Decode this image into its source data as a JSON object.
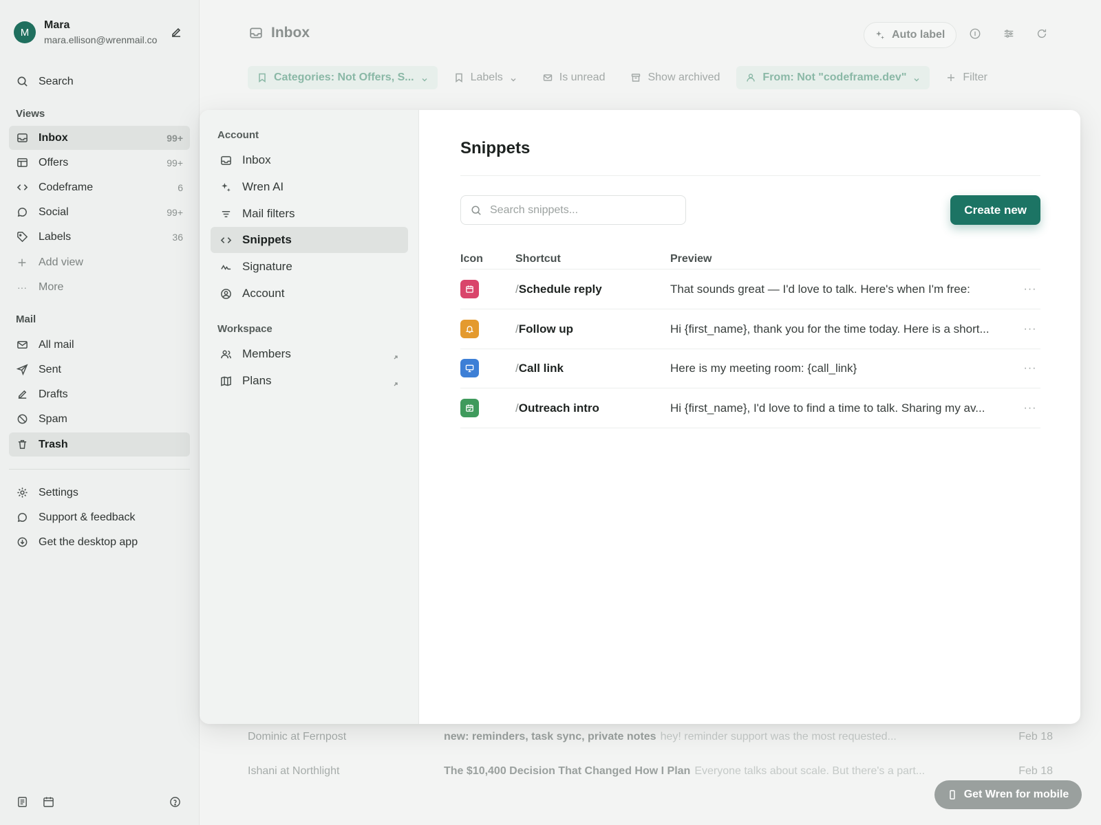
{
  "user": {
    "initial": "M",
    "name": "Mara",
    "email": "mara.ellison@wrenmail.co"
  },
  "search_label": "Search",
  "views": {
    "title": "Views",
    "items": [
      {
        "label": "Inbox",
        "count": "99+"
      },
      {
        "label": "Offers",
        "count": "99+"
      },
      {
        "label": "Codeframe",
        "count": "6"
      },
      {
        "label": "Social",
        "count": "99+"
      },
      {
        "label": "Labels",
        "count": "36"
      }
    ],
    "add_view": "Add view",
    "more": "More"
  },
  "mail": {
    "title": "Mail",
    "items": [
      "All mail",
      "Sent",
      "Drafts",
      "Spam",
      "Trash"
    ]
  },
  "footer_links": [
    "Settings",
    "Support & feedback",
    "Get the desktop app"
  ],
  "main": {
    "title": "Inbox",
    "auto_label": "Auto label",
    "filters": {
      "categories": "Categories: Not Offers, S...",
      "labels": "Labels",
      "is_unread": "Is unread",
      "show_archived": "Show archived",
      "from": "From: Not \"codeframe.dev\"",
      "filter": "Filter"
    },
    "rows": [
      {
        "from": "Dominic at Fernpost",
        "subject": "new: reminders, task sync, private notes",
        "preview": "hey! reminder support was the most requested...",
        "date": "Feb 18"
      },
      {
        "from": "Ishani at Northlight",
        "subject": "The $10,400 Decision That Changed How I Plan",
        "preview": "Everyone talks about scale. But there's a part...",
        "date": "Feb 18"
      }
    ],
    "mobile_button": "Get Wren for mobile"
  },
  "settings": {
    "account_title": "Account",
    "account_items": [
      "Inbox",
      "Wren AI",
      "Mail filters",
      "Snippets",
      "Signature",
      "Account"
    ],
    "workspace_title": "Workspace",
    "workspace_items": [
      "Members",
      "Plans"
    ],
    "active": "Snippets"
  },
  "snippets": {
    "title": "Snippets",
    "search_placeholder": "Search snippets...",
    "create_label": "Create new",
    "columns": {
      "icon": "Icon",
      "shortcut": "Shortcut",
      "preview": "Preview"
    },
    "slash": "/",
    "more_label": "···",
    "rows": [
      {
        "icon": "calendar-icon",
        "color": "#d9456b",
        "shortcut": "Schedule reply",
        "preview": "That sounds great — I'd love to talk. Here's when I'm free:"
      },
      {
        "icon": "bell-icon",
        "color": "#e49a2e",
        "shortcut": "Follow up",
        "preview": "Hi {first_name}, thank you for the time today. Here is a short..."
      },
      {
        "icon": "monitor-icon",
        "color": "#3d7fd6",
        "shortcut": "Call link",
        "preview": "Here is my meeting room: {call_link}"
      },
      {
        "icon": "calendar-check-icon",
        "color": "#3f9a5c",
        "shortcut": "Outreach intro",
        "preview": "Hi {first_name}, I'd love to find a time to talk. Sharing my av..."
      }
    ]
  }
}
